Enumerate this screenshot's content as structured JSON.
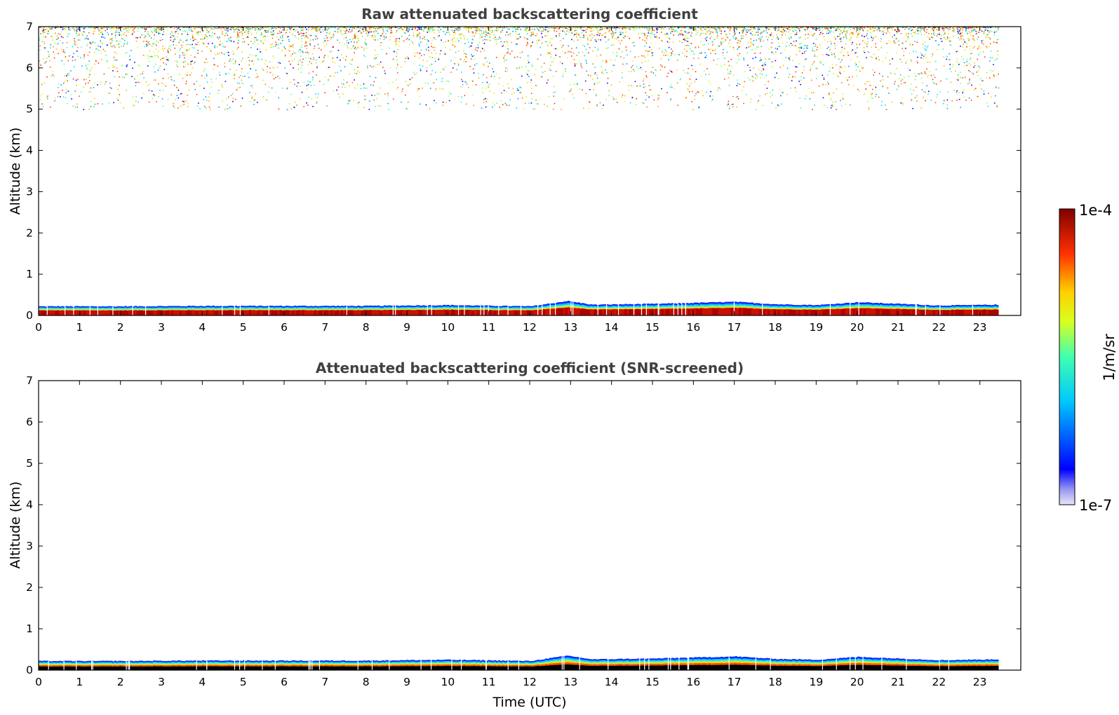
{
  "chart_data": [
    {
      "type": "heatmap",
      "title": "Raw attenuated backscattering coefficient",
      "xlabel": "",
      "ylabel": "Altitude (km)",
      "xlim": [
        0,
        24
      ],
      "ylim": [
        0,
        7
      ],
      "xticks": [
        0,
        1,
        2,
        3,
        4,
        5,
        6,
        7,
        8,
        9,
        10,
        11,
        12,
        13,
        14,
        15,
        16,
        17,
        18,
        19,
        20,
        21,
        22,
        23
      ],
      "yticks": [
        0,
        1,
        2,
        3,
        4,
        5,
        6,
        7
      ],
      "data_time_range": [
        0,
        23.45
      ],
      "features": {
        "boundary_layer_top_km": [
          {
            "t": 0,
            "z": 0.22
          },
          {
            "t": 2,
            "z": 0.22
          },
          {
            "t": 4,
            "z": 0.23
          },
          {
            "t": 6,
            "z": 0.23
          },
          {
            "t": 8,
            "z": 0.23
          },
          {
            "t": 10,
            "z": 0.25
          },
          {
            "t": 12,
            "z": 0.22
          },
          {
            "t": 12.9,
            "z": 0.35
          },
          {
            "t": 13.5,
            "z": 0.26
          },
          {
            "t": 15,
            "z": 0.28
          },
          {
            "t": 17,
            "z": 0.33
          },
          {
            "t": 18,
            "z": 0.27
          },
          {
            "t": 19,
            "z": 0.25
          },
          {
            "t": 20,
            "z": 0.32
          },
          {
            "t": 21,
            "z": 0.28
          },
          {
            "t": 22,
            "z": 0.24
          },
          {
            "t": 23.45,
            "z": 0.26
          }
        ],
        "high_altitude_noise_km": [
          5.0,
          7.0
        ]
      }
    },
    {
      "type": "heatmap",
      "title": "Attenuated backscattering coefficient (SNR-screened)",
      "xlabel": "Time (UTC)",
      "ylabel": "Altitude (km)",
      "xlim": [
        0,
        24
      ],
      "ylim": [
        0,
        7
      ],
      "xticks": [
        0,
        1,
        2,
        3,
        4,
        5,
        6,
        7,
        8,
        9,
        10,
        11,
        12,
        13,
        14,
        15,
        16,
        17,
        18,
        19,
        20,
        21,
        22,
        23
      ],
      "yticks": [
        0,
        1,
        2,
        3,
        4,
        5,
        6,
        7
      ],
      "data_time_range": [
        0,
        23.45
      ],
      "features": {
        "boundary_layer_top_km": [
          {
            "t": 0,
            "z": 0.22
          },
          {
            "t": 2,
            "z": 0.22
          },
          {
            "t": 4,
            "z": 0.23
          },
          {
            "t": 6,
            "z": 0.23
          },
          {
            "t": 8,
            "z": 0.23
          },
          {
            "t": 10,
            "z": 0.25
          },
          {
            "t": 12,
            "z": 0.22
          },
          {
            "t": 12.9,
            "z": 0.35
          },
          {
            "t": 13.5,
            "z": 0.26
          },
          {
            "t": 15,
            "z": 0.28
          },
          {
            "t": 17,
            "z": 0.33
          },
          {
            "t": 18,
            "z": 0.27
          },
          {
            "t": 19,
            "z": 0.25
          },
          {
            "t": 20,
            "z": 0.32
          },
          {
            "t": 21,
            "z": 0.28
          },
          {
            "t": 22,
            "z": 0.24
          },
          {
            "t": 23.45,
            "z": 0.26
          }
        ],
        "high_altitude_noise_km": null,
        "near_ground_masked_black": true
      }
    }
  ],
  "colorbar": {
    "scale": "log",
    "min_label": "1e-7",
    "max_label": "1e-4",
    "unit_label": "1/m/sr",
    "colormap": "jet"
  }
}
